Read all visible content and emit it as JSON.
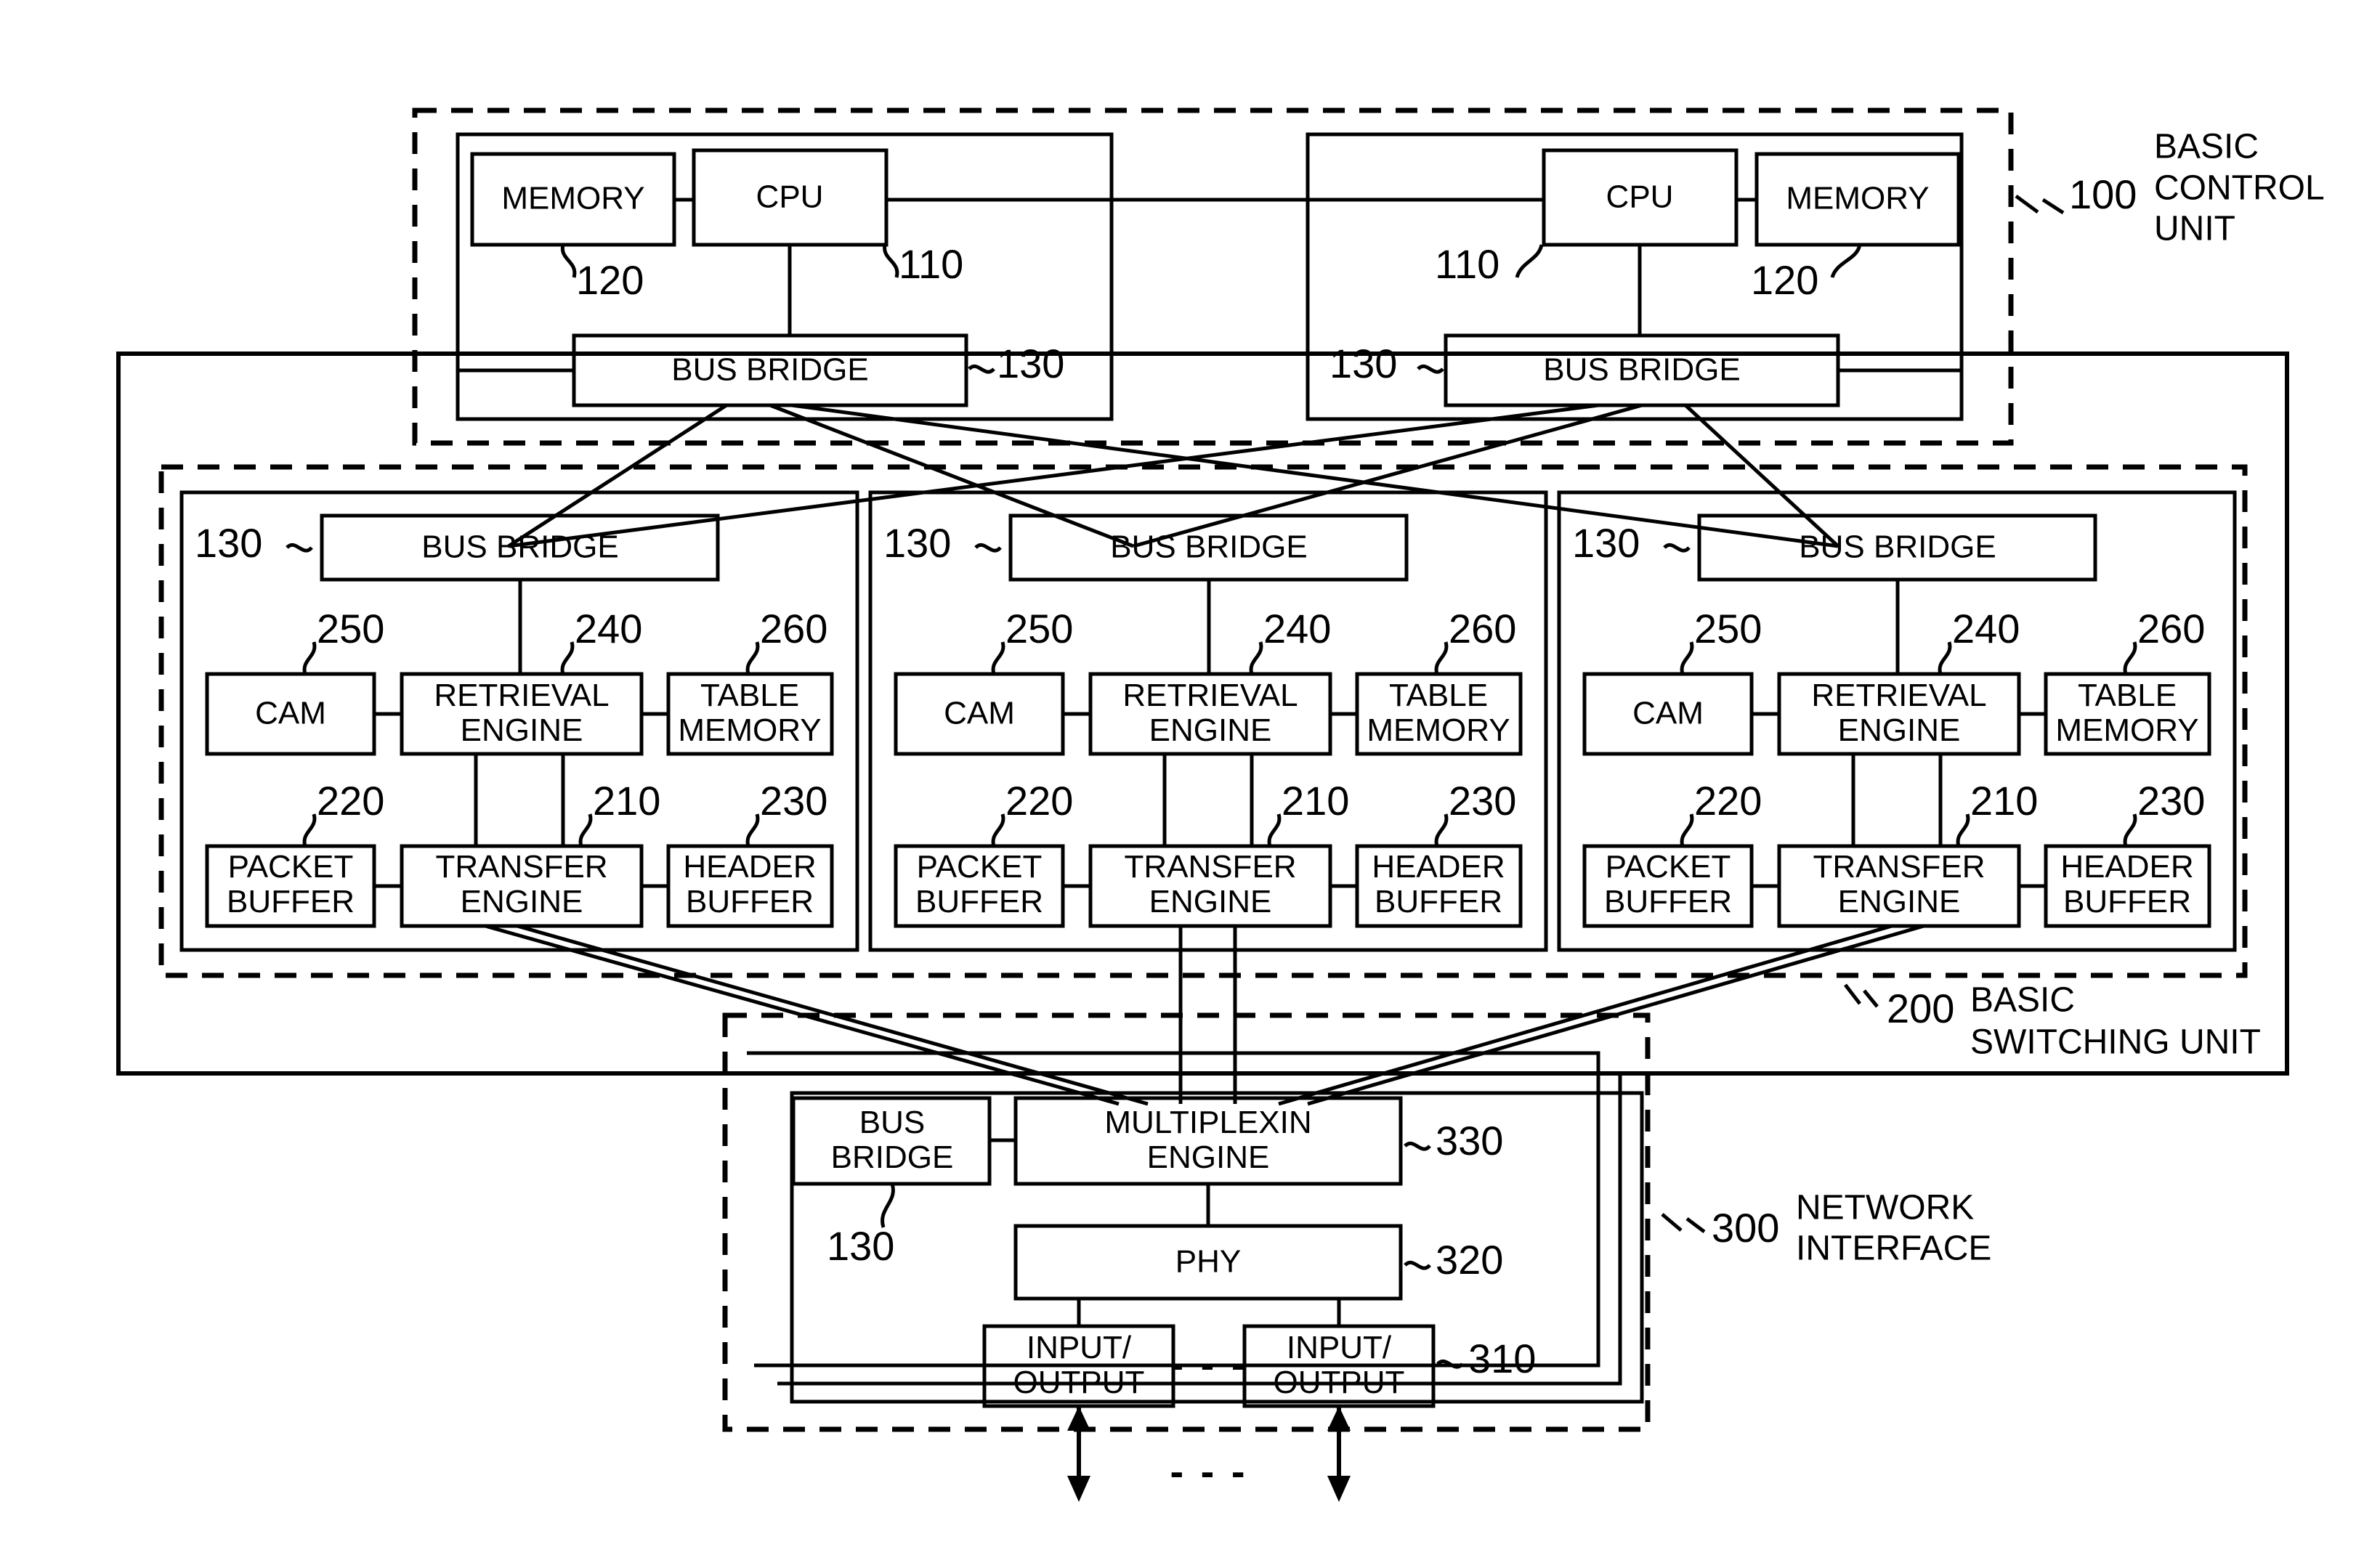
{
  "figure": {
    "type": "block-diagram",
    "description": "Patent block diagram of a network switching apparatus"
  },
  "control_unit": {
    "ref": "100",
    "caption_line1": "BASIC",
    "caption_line2": "CONTROL",
    "caption_line3": "UNIT",
    "left_node": {
      "memory_label": "MEMORY",
      "memory_ref": "120",
      "cpu_label": "CPU",
      "cpu_ref": "110",
      "bus_bridge_label": "BUS BRIDGE",
      "bus_bridge_ref": "130"
    },
    "right_node": {
      "cpu_label": "CPU",
      "cpu_ref": "110",
      "memory_label": "MEMORY",
      "memory_ref": "120",
      "bus_bridge_label": "BUS BRIDGE",
      "bus_bridge_ref": "130"
    }
  },
  "switching_unit": {
    "ref": "200",
    "caption_line1": "BASIC",
    "caption_line2": "SWITCHING UNIT",
    "blocks": [
      {
        "bus_bridge_label": "BUS BRIDGE",
        "bus_bridge_ref": "130",
        "cam_label": "CAM",
        "cam_ref": "250",
        "retrieval_line1": "RETRIEVAL",
        "retrieval_line2": "ENGINE",
        "retrieval_ref": "240",
        "table_line1": "TABLE",
        "table_line2": "MEMORY",
        "table_ref": "260",
        "packet_line1": "PACKET",
        "packet_line2": "BUFFER",
        "packet_ref": "220",
        "transfer_line1": "TRANSFER",
        "transfer_line2": "ENGINE",
        "transfer_ref": "210",
        "header_line1": "HEADER",
        "header_line2": "BUFFER",
        "header_ref": "230"
      },
      {
        "bus_bridge_label": "BUS BRIDGE",
        "bus_bridge_ref": "130",
        "cam_label": "CAM",
        "cam_ref": "250",
        "retrieval_line1": "RETRIEVAL",
        "retrieval_line2": "ENGINE",
        "retrieval_ref": "240",
        "table_line1": "TABLE",
        "table_line2": "MEMORY",
        "table_ref": "260",
        "packet_line1": "PACKET",
        "packet_line2": "BUFFER",
        "packet_ref": "220",
        "transfer_line1": "TRANSFER",
        "transfer_line2": "ENGINE",
        "transfer_ref": "210",
        "header_line1": "HEADER",
        "header_line2": "BUFFER",
        "header_ref": "230"
      },
      {
        "bus_bridge_label": "BUS BRIDGE",
        "bus_bridge_ref": "130",
        "cam_label": "CAM",
        "cam_ref": "250",
        "retrieval_line1": "RETRIEVAL",
        "retrieval_line2": "ENGINE",
        "retrieval_ref": "240",
        "table_line1": "TABLE",
        "table_line2": "MEMORY",
        "table_ref": "260",
        "packet_line1": "PACKET",
        "packet_line2": "BUFFER",
        "packet_ref": "220",
        "transfer_line1": "TRANSFER",
        "transfer_line2": "ENGINE",
        "transfer_ref": "210",
        "header_line1": "HEADER",
        "header_line2": "BUFFER",
        "header_ref": "230"
      }
    ]
  },
  "network_interface": {
    "ref": "300",
    "caption_line1": "NETWORK",
    "caption_line2": "INTERFACE",
    "bus_bridge_line1": "BUS",
    "bus_bridge_line2": "BRIDGE",
    "bus_bridge_ref": "130",
    "multiplexing_line1": "MULTIPLEXIN",
    "multiplexing_line2": "ENGINE",
    "multiplexing_ref": "330",
    "phy_label": "PHY",
    "phy_ref": "320",
    "io_left_line1": "INPUT/",
    "io_left_line2": "OUTPUT",
    "io_right_line1": "INPUT/",
    "io_right_line2": "OUTPUT",
    "io_ref": "310",
    "ellipsis_inline": "- - -",
    "ellipsis_below": "- - -"
  }
}
